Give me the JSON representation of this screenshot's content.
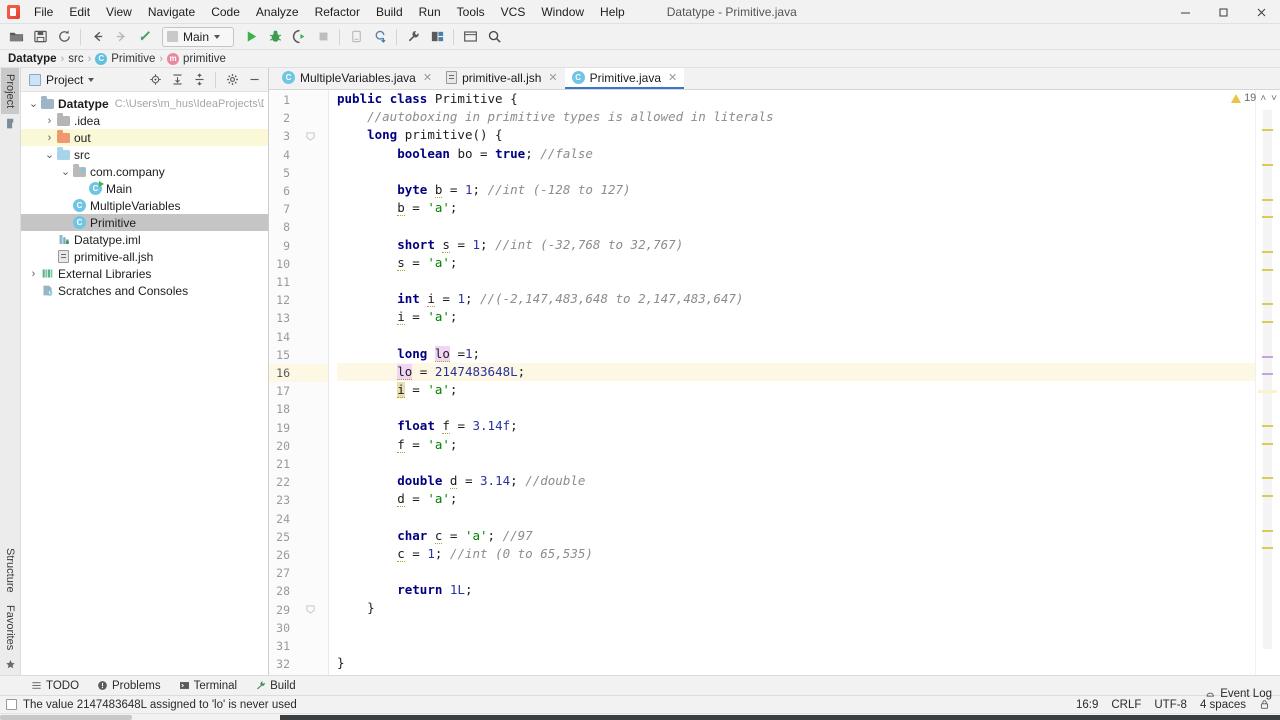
{
  "window": {
    "title": "Datatype - Primitive.java",
    "controls": {
      "minimize": "—",
      "maximize": "❐",
      "close": "✕"
    }
  },
  "menu": {
    "items": [
      "File",
      "Edit",
      "View",
      "Navigate",
      "Code",
      "Analyze",
      "Refactor",
      "Build",
      "Run",
      "Tools",
      "VCS",
      "Window",
      "Help"
    ]
  },
  "toolbar": {
    "run_config": "Main",
    "buttons": [
      "open-project",
      "save-all",
      "sync",
      "back",
      "forward",
      "compile",
      "run",
      "debug",
      "run-with-coverage",
      "stop",
      "attach-profiler",
      "update-project",
      "settings",
      "structure",
      "terminal",
      "search-everywhere"
    ]
  },
  "breadcrumb": {
    "project": "Datatype",
    "source_root": "src",
    "class": "Primitive",
    "method": "primitive",
    "separator": "›"
  },
  "tool_stripe": {
    "left_top": "Project",
    "left_bottom": [
      "Structure",
      "Favorites"
    ]
  },
  "project_panel": {
    "title": "Project",
    "tools": [
      "locate-icon",
      "expand-all-icon",
      "collapse-all-icon",
      "gear-icon",
      "hide-icon"
    ],
    "tree": [
      {
        "label": "Datatype",
        "path": "C:\\Users\\m_hus\\IdeaProjects\\Datatype",
        "icon": "module-folder",
        "indent": 0,
        "arrow": "⌄",
        "bold": true,
        "state": "normal"
      },
      {
        "label": ".idea",
        "path": "",
        "icon": "folder-gray",
        "indent": 1,
        "arrow": "›",
        "bold": false,
        "state": "normal"
      },
      {
        "label": "out",
        "path": "",
        "icon": "folder-orange",
        "indent": 1,
        "arrow": "›",
        "bold": false,
        "state": "excluded"
      },
      {
        "label": "src",
        "path": "",
        "icon": "folder-blue",
        "indent": 1,
        "arrow": "⌄",
        "bold": false,
        "state": "normal"
      },
      {
        "label": "com.company",
        "path": "",
        "icon": "package-folder",
        "indent": 2,
        "arrow": "⌄",
        "bold": false,
        "state": "normal"
      },
      {
        "label": "Main",
        "path": "",
        "icon": "class-runnable",
        "indent": 3,
        "arrow": "",
        "bold": false,
        "state": "normal"
      },
      {
        "label": "MultipleVariables",
        "path": "",
        "icon": "class",
        "indent": 2,
        "arrow": "",
        "bold": false,
        "state": "normal"
      },
      {
        "label": "Primitive",
        "path": "",
        "icon": "class",
        "indent": 2,
        "arrow": "",
        "bold": false,
        "state": "selected"
      },
      {
        "label": "Datatype.iml",
        "path": "",
        "icon": "iml-file",
        "indent": 1,
        "arrow": "",
        "bold": false,
        "state": "normal"
      },
      {
        "label": "primitive-all.jsh",
        "path": "",
        "icon": "jsh-file",
        "indent": 1,
        "arrow": "",
        "bold": false,
        "state": "normal"
      },
      {
        "label": "External Libraries",
        "path": "",
        "icon": "libraries",
        "indent": 0,
        "arrow": "›",
        "bold": false,
        "state": "normal"
      },
      {
        "label": "Scratches and Consoles",
        "path": "",
        "icon": "scratches",
        "indent": 0,
        "arrow": "",
        "bold": false,
        "state": "normal"
      }
    ]
  },
  "editor": {
    "tabs": [
      {
        "label": "MultipleVariables.java",
        "icon": "class-icon",
        "active": false
      },
      {
        "label": "primitive-all.jsh",
        "icon": "jsh-icon",
        "active": false
      },
      {
        "label": "Primitive.java",
        "icon": "class-icon",
        "active": true
      }
    ],
    "current_line": 16,
    "inspection": {
      "warning_count": "19",
      "up": "˄",
      "down": "˅"
    },
    "lines": [
      {
        "n": 1,
        "tokens": [
          {
            "t": "public",
            "c": "kw"
          },
          {
            "t": " ",
            "c": "id"
          },
          {
            "t": "class",
            "c": "kw"
          },
          {
            "t": " Primitive {",
            "c": "id"
          }
        ]
      },
      {
        "n": 2,
        "tokens": [
          {
            "t": "    ",
            "c": "id"
          },
          {
            "t": "//autoboxing in primitive types is allowed in literals",
            "c": "cmt"
          }
        ]
      },
      {
        "n": 3,
        "tokens": [
          {
            "t": "    ",
            "c": "id"
          },
          {
            "t": "long",
            "c": "kw"
          },
          {
            "t": " primitive() {",
            "c": "id"
          }
        ],
        "fold": true
      },
      {
        "n": 4,
        "tokens": [
          {
            "t": "        ",
            "c": "id"
          },
          {
            "t": "boolean",
            "c": "kw"
          },
          {
            "t": " ",
            "c": "id"
          },
          {
            "t": "bo",
            "c": "id"
          },
          {
            "t": " = ",
            "c": "id"
          },
          {
            "t": "true",
            "c": "kw"
          },
          {
            "t": "; ",
            "c": "id"
          },
          {
            "t": "//false",
            "c": "cmt"
          }
        ]
      },
      {
        "n": 5,
        "tokens": []
      },
      {
        "n": 6,
        "tokens": [
          {
            "t": "        ",
            "c": "id"
          },
          {
            "t": "byte",
            "c": "kw"
          },
          {
            "t": " ",
            "c": "id"
          },
          {
            "t": "b",
            "c": "warnu"
          },
          {
            "t": " = ",
            "c": "id"
          },
          {
            "t": "1",
            "c": "num"
          },
          {
            "t": "; ",
            "c": "id"
          },
          {
            "t": "//int (-128 to 127)",
            "c": "cmt"
          }
        ]
      },
      {
        "n": 7,
        "tokens": [
          {
            "t": "        ",
            "c": "id"
          },
          {
            "t": "b",
            "c": "warnu"
          },
          {
            "t": " = ",
            "c": "id"
          },
          {
            "t": "'a'",
            "c": "str"
          },
          {
            "t": ";",
            "c": "id"
          }
        ]
      },
      {
        "n": 8,
        "tokens": []
      },
      {
        "n": 9,
        "tokens": [
          {
            "t": "        ",
            "c": "id"
          },
          {
            "t": "short",
            "c": "kw"
          },
          {
            "t": " ",
            "c": "id"
          },
          {
            "t": "s",
            "c": "warnu"
          },
          {
            "t": " = ",
            "c": "id"
          },
          {
            "t": "1",
            "c": "num"
          },
          {
            "t": "; ",
            "c": "id"
          },
          {
            "t": "//int (-32,768 to 32,767)",
            "c": "cmt"
          }
        ]
      },
      {
        "n": 10,
        "tokens": [
          {
            "t": "        ",
            "c": "id"
          },
          {
            "t": "s",
            "c": "warnu"
          },
          {
            "t": " = ",
            "c": "id"
          },
          {
            "t": "'a'",
            "c": "str"
          },
          {
            "t": ";",
            "c": "id"
          }
        ]
      },
      {
        "n": 11,
        "tokens": []
      },
      {
        "n": 12,
        "tokens": [
          {
            "t": "        ",
            "c": "id"
          },
          {
            "t": "int",
            "c": "kw"
          },
          {
            "t": " ",
            "c": "id"
          },
          {
            "t": "i",
            "c": "warnu"
          },
          {
            "t": " = ",
            "c": "id"
          },
          {
            "t": "1",
            "c": "num"
          },
          {
            "t": "; ",
            "c": "id"
          },
          {
            "t": "//(-2,147,483,648 to 2,147,483,647)",
            "c": "cmt"
          }
        ]
      },
      {
        "n": 13,
        "tokens": [
          {
            "t": "        ",
            "c": "id"
          },
          {
            "t": "i",
            "c": "warnu"
          },
          {
            "t": " = ",
            "c": "id"
          },
          {
            "t": "'a'",
            "c": "str"
          },
          {
            "t": ";",
            "c": "id"
          }
        ]
      },
      {
        "n": 14,
        "tokens": []
      },
      {
        "n": 15,
        "tokens": [
          {
            "t": "        ",
            "c": "id"
          },
          {
            "t": "long",
            "c": "kw"
          },
          {
            "t": " ",
            "c": "id"
          },
          {
            "t": "lo",
            "c": "warnu hl-pink"
          },
          {
            "t": " =",
            "c": "id"
          },
          {
            "t": "1",
            "c": "num"
          },
          {
            "t": ";",
            "c": "id"
          }
        ]
      },
      {
        "n": 16,
        "tokens": [
          {
            "t": "        ",
            "c": "id"
          },
          {
            "t": "lo",
            "c": "warnu hl-pink"
          },
          {
            "t": " = ",
            "c": "id"
          },
          {
            "t": "2147483648L",
            "c": "num"
          },
          {
            "t": ";",
            "c": "id"
          }
        ],
        "current": true
      },
      {
        "n": 17,
        "tokens": [
          {
            "t": "        ",
            "c": "id"
          },
          {
            "t": "i",
            "c": "warnu hl-tan"
          },
          {
            "t": " = ",
            "c": "id"
          },
          {
            "t": "'a'",
            "c": "str"
          },
          {
            "t": ";",
            "c": "id"
          }
        ]
      },
      {
        "n": 18,
        "tokens": []
      },
      {
        "n": 19,
        "tokens": [
          {
            "t": "        ",
            "c": "id"
          },
          {
            "t": "float",
            "c": "kw"
          },
          {
            "t": " ",
            "c": "id"
          },
          {
            "t": "f",
            "c": "warnu"
          },
          {
            "t": " = ",
            "c": "id"
          },
          {
            "t": "3.14f",
            "c": "num"
          },
          {
            "t": ";",
            "c": "id"
          }
        ]
      },
      {
        "n": 20,
        "tokens": [
          {
            "t": "        ",
            "c": "id"
          },
          {
            "t": "f",
            "c": "warnu"
          },
          {
            "t": " = ",
            "c": "id"
          },
          {
            "t": "'a'",
            "c": "str"
          },
          {
            "t": ";",
            "c": "id"
          }
        ]
      },
      {
        "n": 21,
        "tokens": []
      },
      {
        "n": 22,
        "tokens": [
          {
            "t": "        ",
            "c": "id"
          },
          {
            "t": "double",
            "c": "kw"
          },
          {
            "t": " ",
            "c": "id"
          },
          {
            "t": "d",
            "c": "warnu"
          },
          {
            "t": " = ",
            "c": "id"
          },
          {
            "t": "3.14",
            "c": "num"
          },
          {
            "t": "; ",
            "c": "id"
          },
          {
            "t": "//double",
            "c": "cmt"
          }
        ]
      },
      {
        "n": 23,
        "tokens": [
          {
            "t": "        ",
            "c": "id"
          },
          {
            "t": "d",
            "c": "warnu"
          },
          {
            "t": " = ",
            "c": "id"
          },
          {
            "t": "'a'",
            "c": "str"
          },
          {
            "t": ";",
            "c": "id"
          }
        ]
      },
      {
        "n": 24,
        "tokens": []
      },
      {
        "n": 25,
        "tokens": [
          {
            "t": "        ",
            "c": "id"
          },
          {
            "t": "char",
            "c": "kw"
          },
          {
            "t": " ",
            "c": "id"
          },
          {
            "t": "c",
            "c": "warnu"
          },
          {
            "t": " = ",
            "c": "id"
          },
          {
            "t": "'a'",
            "c": "str"
          },
          {
            "t": "; ",
            "c": "id"
          },
          {
            "t": "//97",
            "c": "cmt"
          }
        ]
      },
      {
        "n": 26,
        "tokens": [
          {
            "t": "        ",
            "c": "id"
          },
          {
            "t": "c",
            "c": "warnu"
          },
          {
            "t": " = ",
            "c": "id"
          },
          {
            "t": "1",
            "c": "num"
          },
          {
            "t": "; ",
            "c": "id"
          },
          {
            "t": "//int (0 to 65,535)",
            "c": "cmt"
          }
        ]
      },
      {
        "n": 27,
        "tokens": []
      },
      {
        "n": 28,
        "tokens": [
          {
            "t": "        ",
            "c": "id"
          },
          {
            "t": "return",
            "c": "kw"
          },
          {
            "t": " ",
            "c": "id"
          },
          {
            "t": "1L",
            "c": "num"
          },
          {
            "t": ";",
            "c": "id"
          }
        ]
      },
      {
        "n": 29,
        "tokens": [
          {
            "t": "    }",
            "c": "id"
          }
        ],
        "fold": true
      },
      {
        "n": 30,
        "tokens": []
      },
      {
        "n": 31,
        "tokens": []
      },
      {
        "n": 32,
        "tokens": [
          {
            "t": "}",
            "c": "id"
          }
        ]
      }
    ]
  },
  "tool_windows": [
    {
      "label": "TODO",
      "icon": "todo-icon"
    },
    {
      "label": "Problems",
      "icon": "problems-icon"
    },
    {
      "label": "Terminal",
      "icon": "terminal-icon"
    },
    {
      "label": "Build",
      "icon": "build-icon"
    }
  ],
  "status_bar": {
    "message": "The value 2147483648L assigned to 'lo' is never used",
    "event_log": "Event Log",
    "caret_position": "16:9",
    "line_separator": "CRLF",
    "encoding": "UTF-8",
    "indent": "4 spaces",
    "lock": "lock-icon"
  },
  "colors": {
    "accent_blue": "#3a77c9",
    "keyword": "#000080",
    "string": "#008000",
    "number": "#2a32a0",
    "comment": "#8c8c8c",
    "caret_line": "#fdf8e4",
    "identifier_highlight": "#f0d5f5",
    "excluded_folder": "#fbf8d8",
    "warning": "#e8c547",
    "chrome": "#f2f2f2"
  }
}
